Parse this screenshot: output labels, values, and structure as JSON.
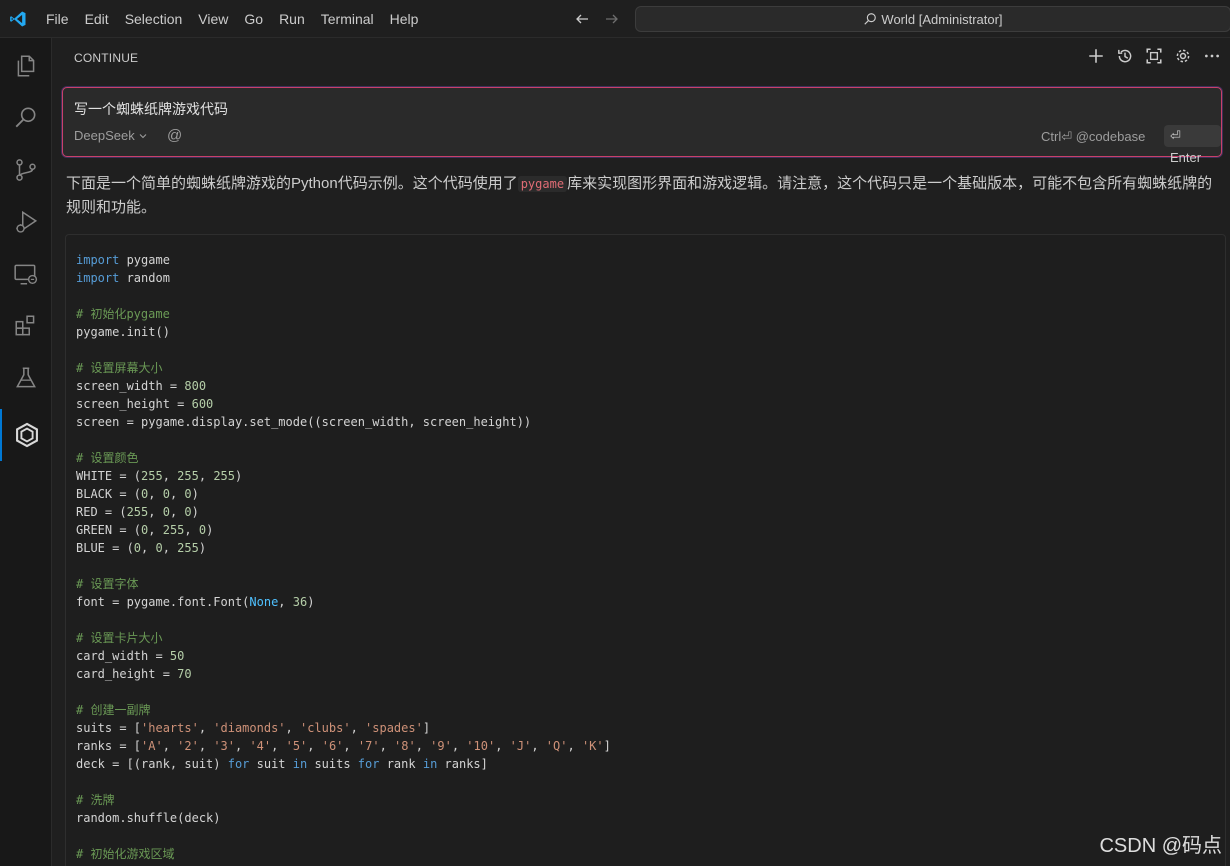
{
  "titlebar": {
    "menu": [
      "File",
      "Edit",
      "Selection",
      "View",
      "Go",
      "Run",
      "Terminal",
      "Help"
    ],
    "search_text": "World [Administrator]"
  },
  "activitybar": {
    "icons": [
      "explorer-icon",
      "search-icon",
      "source-control-icon",
      "run-debug-icon",
      "remote-explorer-icon",
      "extensions-icon",
      "testing-icon",
      "continue-icon"
    ]
  },
  "panel": {
    "title": "CONTINUE",
    "input": {
      "prompt": "写一个蜘蛛纸牌游戏代码",
      "model": "DeepSeek",
      "at_symbol": "@",
      "ctrl_hint": "Ctrl⏎ @codebase",
      "enter_label": "⏎ Enter"
    },
    "response": {
      "intro_before": "下面是一个简单的蜘蛛纸牌游戏的Python代码示例。这个代码使用了",
      "inline_code": "pygame",
      "intro_after": "库来实现图形界面和游戏逻辑。请注意，这个代码只是一个基础版本，可能不包含所有蜘蛛纸牌的规则和功能。"
    }
  },
  "code": [
    "import pygame",
    "import random",
    "",
    "# 初始化pygame",
    "pygame.init()",
    "",
    "# 设置屏幕大小",
    "screen_width = 800",
    "screen_height = 600",
    "screen = pygame.display.set_mode((screen_width, screen_height))",
    "",
    "# 设置颜色",
    "WHITE = (255, 255, 255)",
    "BLACK = (0, 0, 0)",
    "RED = (255, 0, 0)",
    "GREEN = (0, 255, 0)",
    "BLUE = (0, 0, 255)",
    "",
    "# 设置字体",
    "font = pygame.font.Font(None, 36)",
    "",
    "# 设置卡片大小",
    "card_width = 50",
    "card_height = 70",
    "",
    "# 创建一副牌",
    "suits = ['hearts', 'diamonds', 'clubs', 'spades']",
    "ranks = ['A', '2', '3', '4', '5', '6', '7', '8', '9', '10', 'J', 'Q', 'K']",
    "deck = [(rank, suit) for suit in suits for rank in ranks]",
    "",
    "# 洗牌",
    "random.shuffle(deck)",
    "",
    "# 初始化游戏区域"
  ],
  "watermark": "CSDN @码点"
}
